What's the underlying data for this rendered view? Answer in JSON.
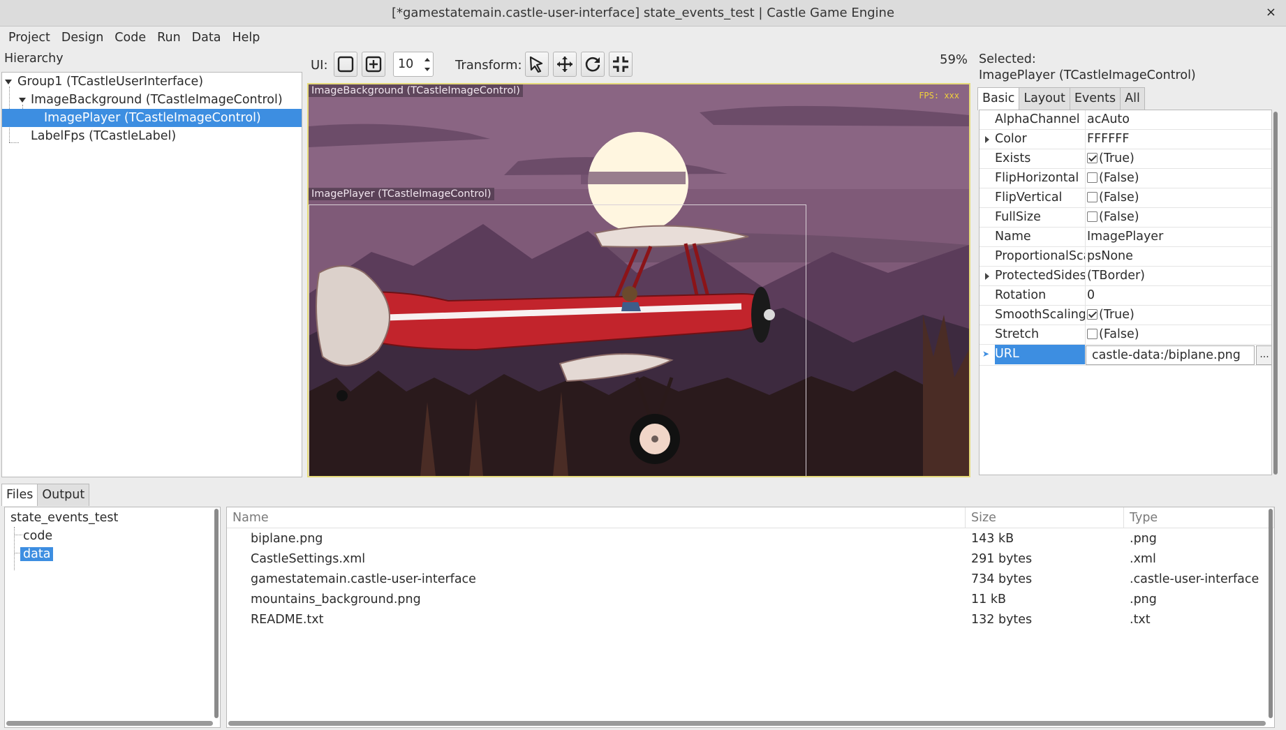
{
  "window": {
    "title": "[*gamestatemain.castle-user-interface] state_events_test | Castle Game Engine",
    "close_glyph": "×"
  },
  "menu": [
    "Project",
    "Design",
    "Code",
    "Run",
    "Data",
    "Help"
  ],
  "hierarchy": {
    "label": "Hierarchy",
    "items": [
      {
        "label": "Group1 (TCastleUserInterface)",
        "level": 0,
        "expanded": true
      },
      {
        "label": "ImageBackground (TCastleImageControl)",
        "level": 1,
        "expanded": true
      },
      {
        "label": "ImagePlayer (TCastleImageControl)",
        "level": 2,
        "selected": true
      },
      {
        "label": "LabelFps (TCastleLabel)",
        "level": 1
      }
    ]
  },
  "toolbar": {
    "ui_label": "UI:",
    "spin_value": "10",
    "transform_label": "Transform:",
    "zoom": "59%",
    "icons": [
      "select-ui-icon",
      "add-ui-icon",
      "select-arrow-icon",
      "move-icon",
      "rotate-icon",
      "resize-icon"
    ]
  },
  "viewport": {
    "background_label": "ImageBackground (TCastleImageControl)",
    "player_label": "ImagePlayer (TCastleImageControl)",
    "fps_label": "FPS: xxx",
    "colors": {
      "sky": "#7f5a78",
      "sun": "#fff6e0",
      "mountains_far": "#5b3c5a",
      "mountains_near": "#3d2a3f",
      "forest": "#2a1a1c",
      "plane_body": "#c2242c",
      "frame_border": "#e6db7a"
    }
  },
  "inspector": {
    "selected_label": "Selected:",
    "selected_name": "ImagePlayer (TCastleImageControl)",
    "tabs": [
      "Basic",
      "Layout",
      "Events",
      "All"
    ],
    "active_tab": "Basic",
    "properties": [
      {
        "name": "AlphaChannel",
        "value": "acAuto"
      },
      {
        "name": "Color",
        "value": "FFFFFF",
        "expandable": true
      },
      {
        "name": "Exists",
        "value": "(True)",
        "checkbox": true,
        "checked": true
      },
      {
        "name": "FlipHorizontal",
        "value": "(False)",
        "checkbox": true,
        "checked": false
      },
      {
        "name": "FlipVertical",
        "value": "(False)",
        "checkbox": true,
        "checked": false
      },
      {
        "name": "FullSize",
        "value": "(False)",
        "checkbox": true,
        "checked": false
      },
      {
        "name": "Name",
        "value": "ImagePlayer"
      },
      {
        "name": "ProportionalScaling",
        "value": "psNone"
      },
      {
        "name": "ProtectedSides",
        "value": "(TBorder)",
        "expandable": true
      },
      {
        "name": "Rotation",
        "value": "0"
      },
      {
        "name": "SmoothScaling",
        "value": "(True)",
        "checkbox": true,
        "checked": true
      },
      {
        "name": "Stretch",
        "value": "(False)",
        "checkbox": true,
        "checked": false
      },
      {
        "name": "URL",
        "value": "castle-data:/biplane.png",
        "selected": true,
        "editing": true
      }
    ],
    "browse_label": "..."
  },
  "bottom": {
    "tabs": [
      "Files",
      "Output"
    ],
    "active_tab": "Files",
    "tree": [
      {
        "label": "state_events_test",
        "level": 0
      },
      {
        "label": "code",
        "level": 1
      },
      {
        "label": "data",
        "level": 1,
        "selected": true
      }
    ],
    "columns": [
      "Name",
      "Size",
      "Type"
    ],
    "files": [
      {
        "name": "biplane.png",
        "size": "143 kB",
        "type": ".png"
      },
      {
        "name": "CastleSettings.xml",
        "size": "291 bytes",
        "type": ".xml"
      },
      {
        "name": "gamestatemain.castle-user-interface",
        "size": "734 bytes",
        "type": ".castle-user-interface"
      },
      {
        "name": "mountains_background.png",
        "size": "11 kB",
        "type": ".png"
      },
      {
        "name": "README.txt",
        "size": "132 bytes",
        "type": ".txt"
      }
    ]
  }
}
